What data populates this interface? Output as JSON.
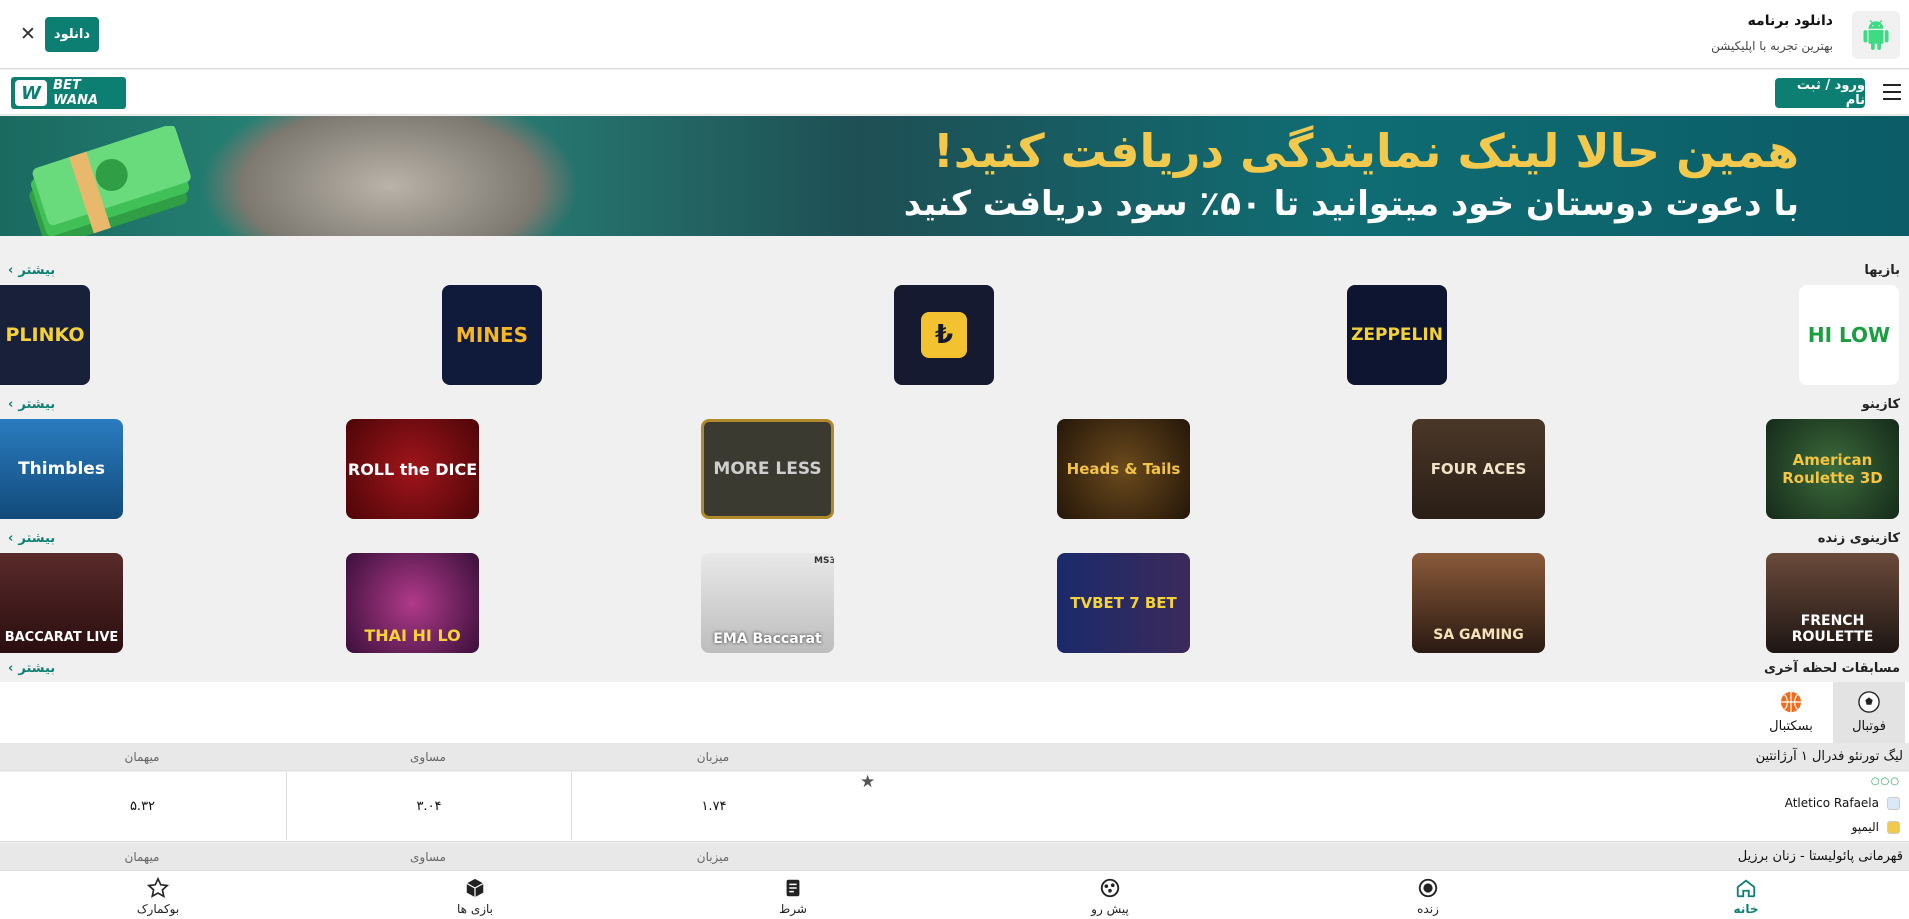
{
  "download_bar": {
    "title": "دانلود برنامه",
    "subtitle": "بهترین تجربه با اپلیکیشن",
    "button": "دانلود",
    "close": "✕"
  },
  "header": {
    "login_button": "ورود / ثبت نام",
    "logo_text": "BET WANA",
    "logo_mark": "W"
  },
  "banner": {
    "line1": "همین حالا لینک نمایندگی دریافت کنید!",
    "line2": "با دعوت دوستان خود میتوانید تا ۵۰٪ سود دریافت کنید"
  },
  "more_label": "بیشتر",
  "sections": {
    "games": {
      "title": "بازیها",
      "items": [
        "HI LOW",
        "ZEPPELIN",
        "₺",
        "MINES",
        "PLINKO"
      ]
    },
    "casino": {
      "title": "کازینو",
      "items": [
        "American Roulette 3D",
        "FOUR ACES",
        "Heads & Tails",
        "MORE LESS",
        "ROLL the DICE",
        "Thimbles"
      ]
    },
    "live_casino": {
      "title": "کازینوی زنده",
      "items": [
        "FRENCH ROULETTE",
        "SA GAMING",
        "TVBET 7 BET",
        "EMA Baccarat",
        "THAI HI LO",
        "BACCARAT LIVE"
      ],
      "ema_tag": "MS3"
    },
    "last_minute": {
      "title": "مسابقات لحظه آخری"
    }
  },
  "sports": {
    "tabs": [
      {
        "label": "فوتبال",
        "active": true
      },
      {
        "label": "بسکتبال",
        "active": false
      }
    ]
  },
  "odds_headers": {
    "home": "میزبان",
    "draw": "مساوی",
    "away": "میهمان"
  },
  "leagues": [
    {
      "name": "لیگ تورنئو فدرال ۱ آرژانتین",
      "match": {
        "status": "○○○",
        "home": "Atletico Rafaela",
        "away": "الیمپو",
        "odds": {
          "home": "۱.۷۴",
          "draw": "۳.۰۴",
          "away": "۵.۳۲"
        }
      }
    },
    {
      "name": "قهرمانی پائولیستا - زنان برزیل"
    }
  ],
  "bottom_nav": [
    {
      "label": "خانه",
      "icon": "home-icon",
      "active": true
    },
    {
      "label": "زنده",
      "icon": "live-icon",
      "active": false
    },
    {
      "label": "پیش رو",
      "icon": "upcoming-icon",
      "active": false
    },
    {
      "label": "شرط",
      "icon": "betslip-icon",
      "active": false
    },
    {
      "label": "بازی ها",
      "icon": "games-icon",
      "active": false
    },
    {
      "label": "بوکمارک",
      "icon": "bookmark-icon",
      "active": false
    }
  ],
  "colors": {
    "accent": "#0d7f72",
    "banner_yellow": "#f2c94c"
  }
}
